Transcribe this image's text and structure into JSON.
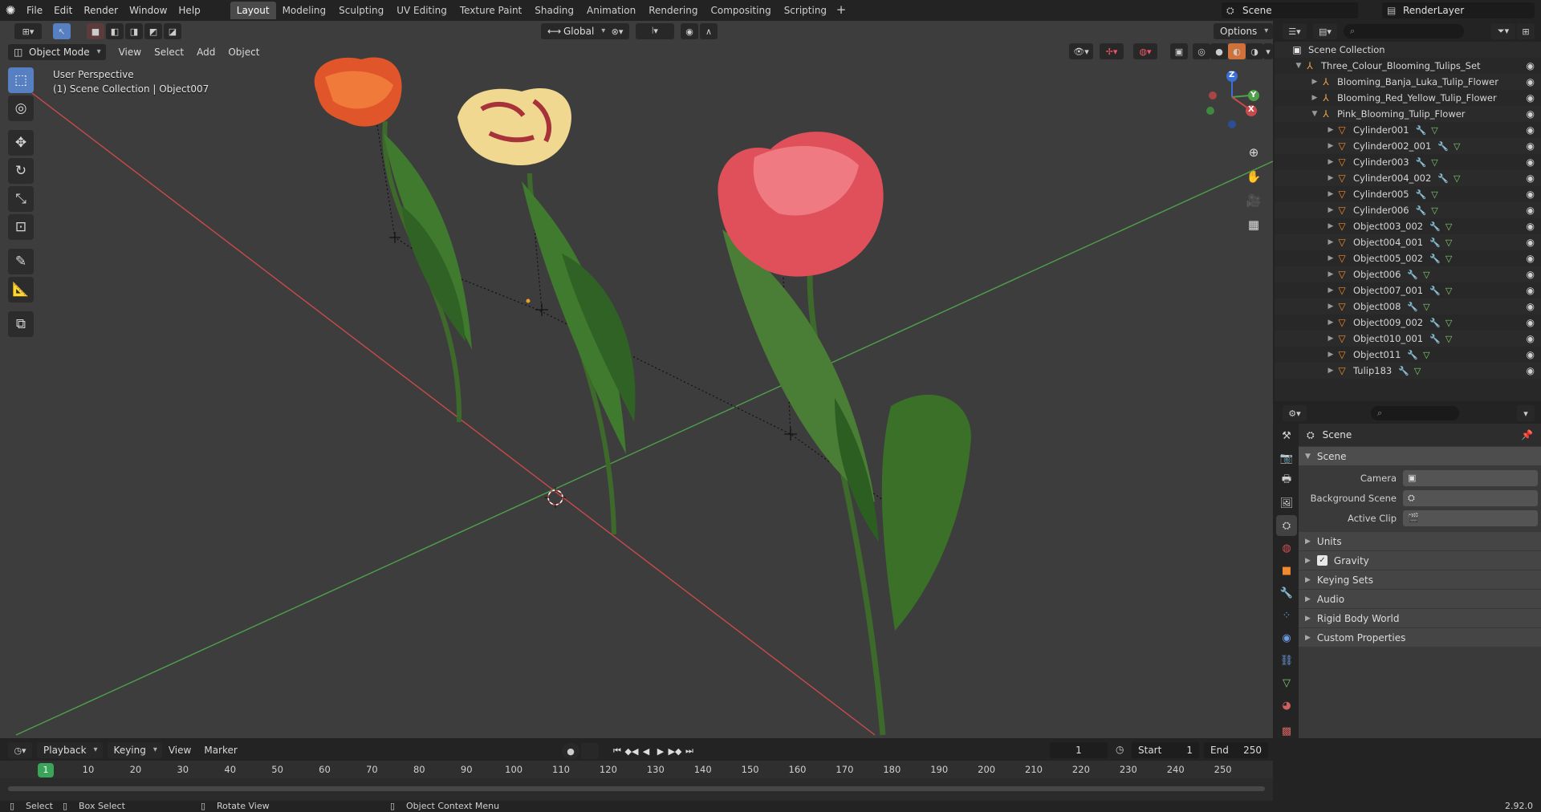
{
  "topbar": {
    "menu": [
      "File",
      "Edit",
      "Render",
      "Window",
      "Help"
    ],
    "workspaces": [
      "Layout",
      "Modeling",
      "Sculpting",
      "UV Editing",
      "Texture Paint",
      "Shading",
      "Animation",
      "Rendering",
      "Compositing",
      "Scripting"
    ],
    "active_workspace": "Layout",
    "scene_name": "Scene",
    "view_layer": "RenderLayer"
  },
  "viewport": {
    "mode": "Object Mode",
    "menus": [
      "View",
      "Select",
      "Add",
      "Object"
    ],
    "transform_orientation": "Global",
    "options_label": "Options",
    "perspective_label": "User Perspective",
    "context_label": "(1) Scene Collection | Object007",
    "gizmo_axes": {
      "x": "X",
      "y": "Y",
      "z": "Z"
    }
  },
  "outliner": {
    "root": "Scene Collection",
    "set": "Three_Colour_Blooming_Tulips_Set",
    "children": [
      {
        "name": "Blooming_Banja_Luka_Tulip_Flower",
        "expanded": false
      },
      {
        "name": "Blooming_Red_Yellow_Tulip_Flower",
        "expanded": false
      },
      {
        "name": "Pink_Blooming_Tulip_Flower",
        "expanded": true
      }
    ],
    "objects": [
      "Cylinder001",
      "Cylinder002_001",
      "Cylinder003",
      "Cylinder004_002",
      "Cylinder005",
      "Cylinder006",
      "Object003_002",
      "Object004_001",
      "Object005_002",
      "Object006",
      "Object007_001",
      "Object008",
      "Object009_002",
      "Object010_001",
      "Object011",
      "Tulip183"
    ]
  },
  "properties": {
    "title": "Scene",
    "panel": "Scene",
    "fields": [
      {
        "label": "Camera",
        "value": ""
      },
      {
        "label": "Background Scene",
        "value": ""
      },
      {
        "label": "Active Clip",
        "value": ""
      }
    ],
    "subpanels": [
      "Units",
      "Gravity",
      "Keying Sets",
      "Audio",
      "Rigid Body World",
      "Custom Properties"
    ],
    "gravity_checked": true
  },
  "timeline": {
    "menus": [
      "Playback",
      "Keying",
      "View",
      "Marker"
    ],
    "current_frame": "1",
    "start_label": "Start",
    "start": "1",
    "end_label": "End",
    "end": "250",
    "ruler_ticks": [
      "10",
      "20",
      "30",
      "40",
      "50",
      "60",
      "70",
      "80",
      "90",
      "100",
      "110",
      "120",
      "130",
      "140",
      "150",
      "160",
      "170",
      "180",
      "190",
      "200",
      "210",
      "220",
      "230",
      "240",
      "250"
    ],
    "ruler_current": "1"
  },
  "statusbar": {
    "select": "Select",
    "box_select": "Box Select",
    "rotate_view": "Rotate View",
    "context_menu": "Object Context Menu",
    "version": "2.92.0"
  },
  "colors": {
    "accent": "#5680c2",
    "x_axis": "#c94a4a",
    "y_axis": "#4fa04a",
    "active_frame": "#3aa45a"
  }
}
